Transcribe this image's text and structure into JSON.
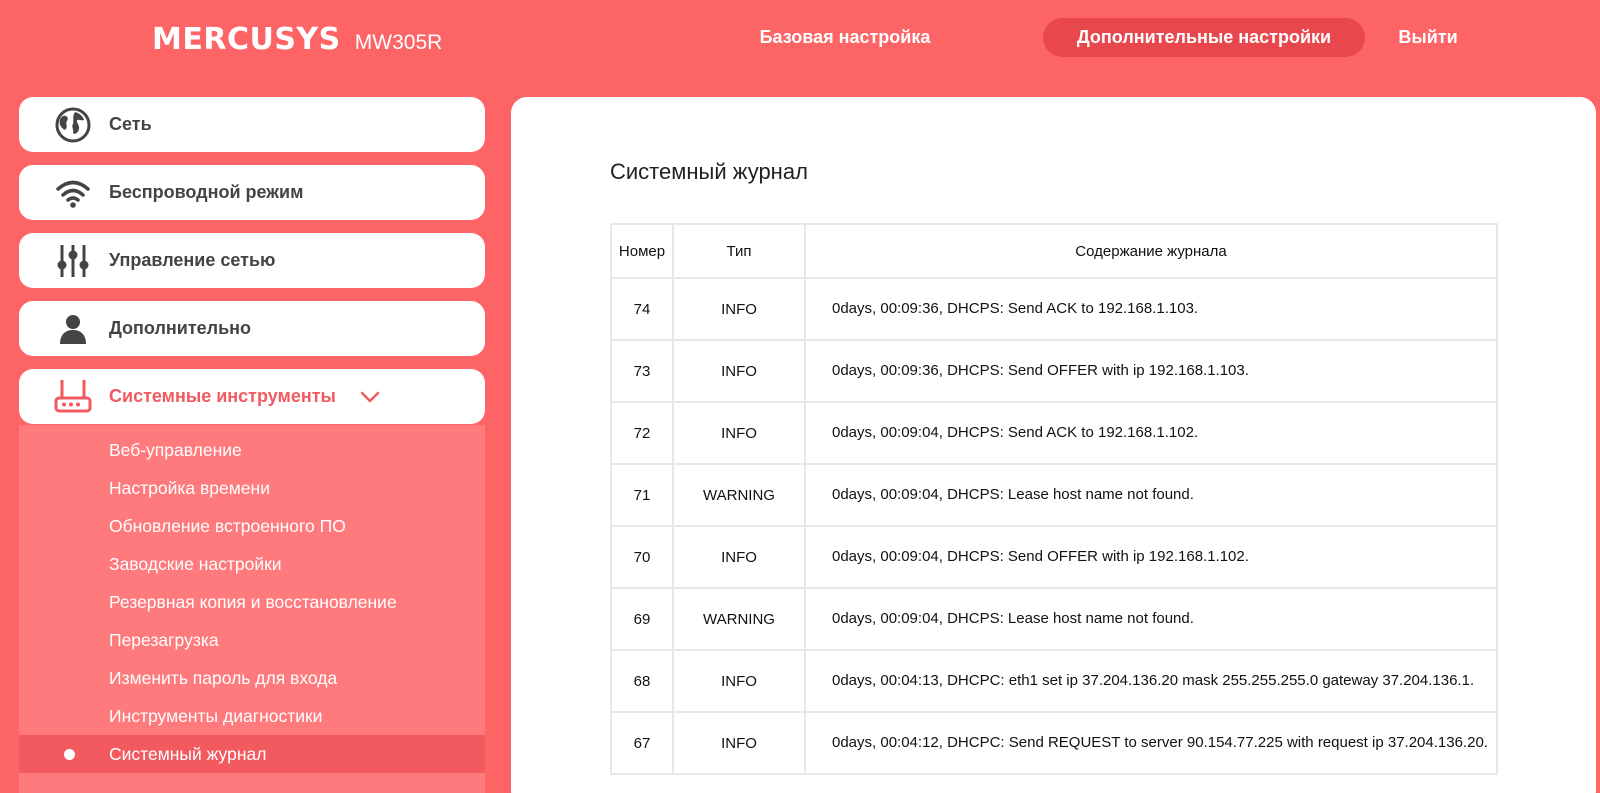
{
  "header": {
    "brand": "MERCUSYS",
    "model": "MW305R",
    "nav": {
      "basic": "Базовая настройка",
      "advanced": "Дополнительные настройки",
      "logout": "Выйти"
    }
  },
  "sidebar": {
    "items": [
      {
        "label": "Сеть",
        "icon": "globe-icon"
      },
      {
        "label": "Беспроводной режим",
        "icon": "wifi-icon"
      },
      {
        "label": "Управление сетью",
        "icon": "sliders-icon"
      },
      {
        "label": "Дополнительно",
        "icon": "user-icon"
      },
      {
        "label": "Системные инструменты",
        "icon": "router-icon"
      }
    ],
    "submenu": [
      "Веб-управление",
      "Настройка времени",
      "Обновление встроенного ПО",
      "Заводские настройки",
      "Резервная копия и восстановление",
      "Перезагрузка",
      "Изменить пароль для входа",
      "Инструменты диагностики",
      "Системный журнал"
    ]
  },
  "main": {
    "title": "Системный журнал",
    "columns": {
      "num": "Номер",
      "type": "Тип",
      "content": "Содержание журнала"
    },
    "rows": [
      {
        "num": "74",
        "type": "INFO",
        "content": "0days, 00:09:36, DHCPS: Send ACK to 192.168.1.103."
      },
      {
        "num": "73",
        "type": "INFO",
        "content": "0days, 00:09:36, DHCPS: Send OFFER with ip 192.168.1.103."
      },
      {
        "num": "72",
        "type": "INFO",
        "content": "0days, 00:09:04, DHCPS: Send ACK to 192.168.1.102."
      },
      {
        "num": "71",
        "type": "WARNING",
        "content": "0days, 00:09:04, DHCPS: Lease host name not found."
      },
      {
        "num": "70",
        "type": "INFO",
        "content": "0days, 00:09:04, DHCPS: Send OFFER with ip 192.168.1.102."
      },
      {
        "num": "69",
        "type": "WARNING",
        "content": "0days, 00:09:04, DHCPS: Lease host name not found."
      },
      {
        "num": "68",
        "type": "INFO",
        "content": "0days, 00:04:13, DHCPC: eth1 set ip 37.204.136.20 mask 255.255.255.0 gateway 37.204.136.1."
      },
      {
        "num": "67",
        "type": "INFO",
        "content": "0days, 00:04:12, DHCPC: Send REQUEST to server 90.154.77.225 with request ip 37.204.136.20."
      }
    ]
  },
  "colors": {
    "brand_red": "#fd6466",
    "active_nav": "#e8484d",
    "submenu_bg": "#ff7a7c",
    "active_accent": "#f15a5f"
  }
}
